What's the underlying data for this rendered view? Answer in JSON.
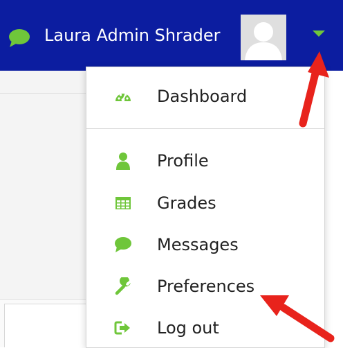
{
  "navbar": {
    "user_name": "Laura Admin Shrader",
    "icons": {
      "messages": "chat-bubble-icon",
      "avatar": "user-silhouette-icon",
      "dropdown": "caret-down-icon"
    }
  },
  "menu": {
    "items": [
      {
        "label": "Dashboard",
        "icon": "tachometer-icon"
      },
      {
        "label": "Profile",
        "icon": "user-icon"
      },
      {
        "label": "Grades",
        "icon": "table-grid-icon"
      },
      {
        "label": "Messages",
        "icon": "comment-icon"
      },
      {
        "label": "Preferences",
        "icon": "wrench-icon"
      },
      {
        "label": "Log out",
        "icon": "sign-out-icon"
      }
    ]
  },
  "colors": {
    "navbar": "#0c1da0",
    "icon_green": "#6fc63a",
    "annotation_red": "#e8231c"
  }
}
